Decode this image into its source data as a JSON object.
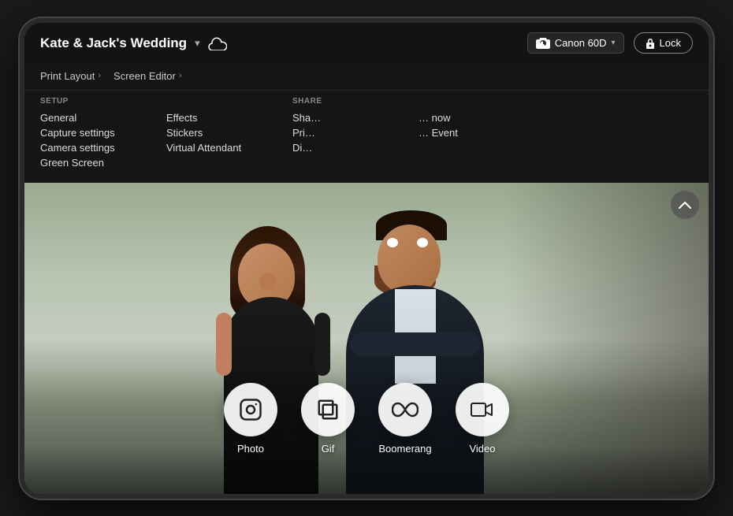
{
  "app": {
    "title": "Kate & Jack's Wedding",
    "dropdown_icon": "▾",
    "cloud_label": "cloud"
  },
  "header": {
    "camera_label": "Canon 60D",
    "lock_label": "Lock"
  },
  "menu": {
    "top_items": [
      {
        "label": "Print Layout",
        "arrow": "›"
      },
      {
        "label": "Screen Editor",
        "arrow": "›"
      }
    ],
    "columns": [
      {
        "header": "SETUP",
        "items": [
          "General",
          "Capture settings",
          "Camera settings",
          "Green Screen"
        ]
      },
      {
        "header": "",
        "items": [
          "Effects",
          "Stickers",
          "Virtual Attendant"
        ]
      },
      {
        "header": "SHARE",
        "items": [
          "Share",
          "Print",
          "Dis…"
        ]
      },
      {
        "header": "",
        "items": [
          "… now",
          "… Event",
          ""
        ]
      }
    ]
  },
  "capture_modes": [
    {
      "id": "photo",
      "label": "Photo",
      "icon": "instagram"
    },
    {
      "id": "gif",
      "label": "Gif",
      "icon": "layers"
    },
    {
      "id": "boomerang",
      "label": "Boomerang",
      "icon": "infinity"
    },
    {
      "id": "video",
      "label": "Video",
      "icon": "video"
    }
  ],
  "scroll_up_icon": "chevron-up",
  "colors": {
    "bg_dark": "#141414",
    "nav_bg": "#1a1a1a",
    "accent": "#fff"
  }
}
